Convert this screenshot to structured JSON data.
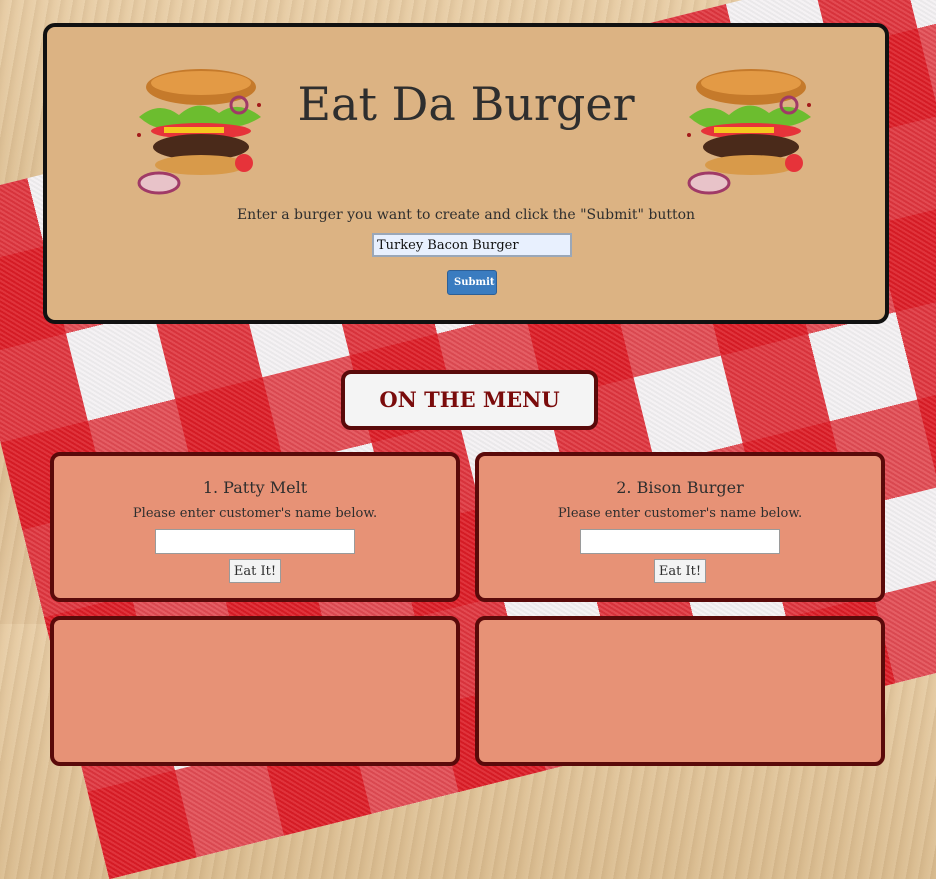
{
  "header": {
    "title": "Eat Da Burger",
    "instructions": "Enter a burger you want to create and click the \"Submit\" button",
    "input_value": "Turkey Bacon Burger",
    "submit_label": "Submit"
  },
  "menu": {
    "title": "ON THE MENU",
    "items": [
      {
        "name": "1. Patty Melt",
        "prompt": "Please enter customer's name below.",
        "button": "Eat It!"
      },
      {
        "name": "2. Bison Burger",
        "prompt": "Please enter customer's name below.",
        "button": "Eat It!"
      }
    ]
  }
}
